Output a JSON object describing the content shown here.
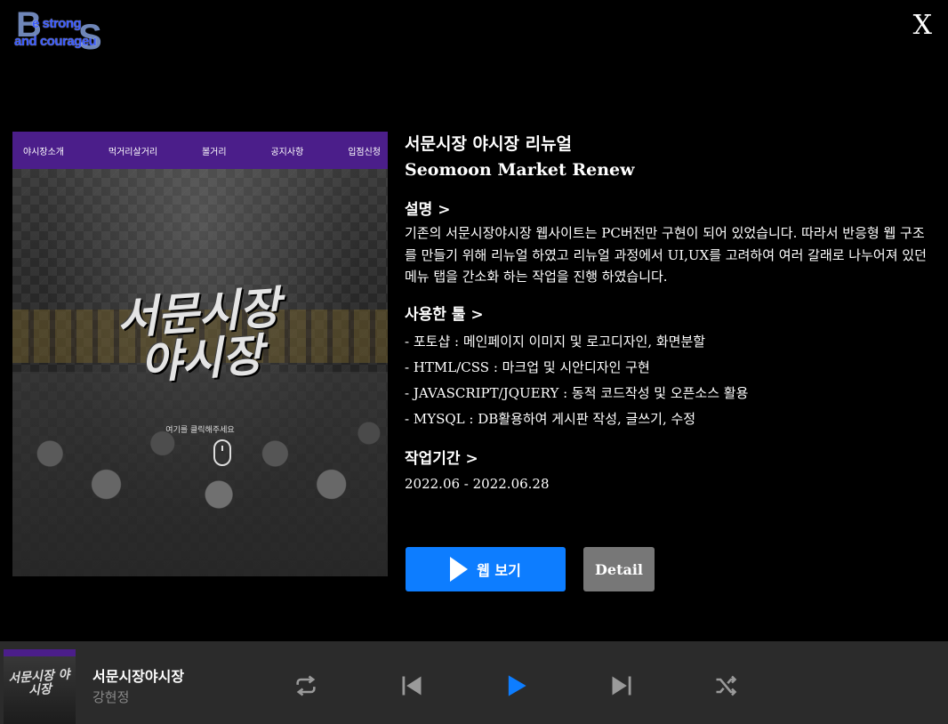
{
  "logo": {
    "big_b": "B",
    "big_s": "S",
    "line1": "e strong",
    "line2": "and courageu"
  },
  "close_label": "X",
  "preview": {
    "nav": [
      "야시장소개",
      "먹거리살거리",
      "볼거리",
      "공지사항",
      "입점신청"
    ],
    "title_line1": "서문시장",
    "title_line2": "야시장",
    "hint": "여기를 클릭해주세요"
  },
  "project": {
    "title_ko": "서문시장 야시장 리뉴얼",
    "title_en": "Seomoon Market Renew",
    "desc_heading": "설명 >",
    "description": "기존의 서문시장야시장 웹사이트는 PC버전만 구현이 되어 있었습니다. 따라서 반응형 웹 구조를 만들기 위해 리뉴얼 하였고 리뉴얼 과정에서 UI,UX를 고려하여 여러 갈래로 나누어져 있던 메뉴 탭을 간소화 하는 작업을 진행 하였습니다.",
    "tools_heading": "사용한 툴 >",
    "tools": [
      "- 포토샵 : 메인페이지 이미지 및 로고디자인, 화면분할",
      "- HTML/CSS : 마크업 및 시안디자인 구현",
      "- JAVASCRIPT/JQUERY : 동적 코드작성 및 오픈소스 활용",
      "- MYSQL : DB활용하여 게시판 작성, 글쓰기, 수정"
    ],
    "period_heading": "작업기간 >",
    "period": "2022.06 - 2022.06.28"
  },
  "buttons": {
    "web_label": "웹 보기",
    "detail_label": "Detail"
  },
  "player": {
    "thumb_title": "서문시장 야시장",
    "song": "서문시장야시장",
    "artist": "강현정",
    "accent": "#0d7dff",
    "icon_color": "#9a9a9a"
  }
}
